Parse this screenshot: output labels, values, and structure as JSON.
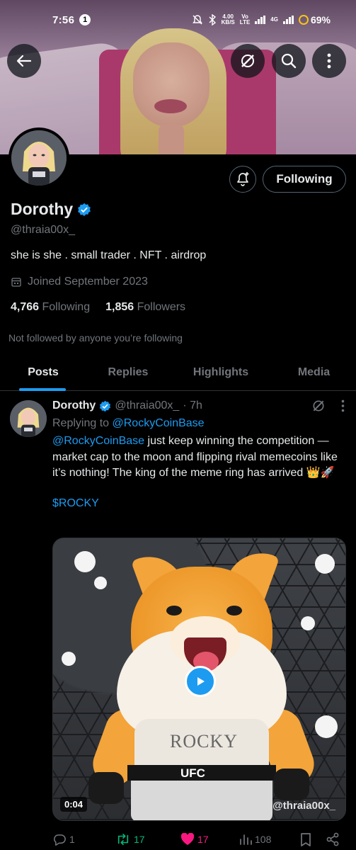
{
  "status_bar": {
    "time": "7:56",
    "notification_count": "1",
    "speed_value": "4.00",
    "speed_unit": "KB/S",
    "network_vo": "Vo",
    "network_lte": "LTE",
    "network_4g": "4G",
    "battery": "69%"
  },
  "profile": {
    "name": "Dorothy",
    "handle": "@thraia00x_",
    "bio": "she is she . small trader . NFT . airdrop",
    "joined": "Joined September 2023",
    "following_count": "4,766",
    "following_label": "Following",
    "followers_count": "1,856",
    "followers_label": "Followers",
    "not_followed": "Not followed by anyone you’re following",
    "follow_button": "Following",
    "verified_color": "#1d9bf0"
  },
  "tabs": [
    "Posts",
    "Replies",
    "Highlights",
    "Media"
  ],
  "active_tab": "Posts",
  "post": {
    "name": "Dorothy",
    "handle": "@thraia00x_",
    "time": "· 7h",
    "replying_prefix": "Replying to",
    "replying_to": "@RockyCoinBase",
    "text_mention": "@RockyCoinBase",
    "text": " just keep winning the competition — market cap to the moon and flipping rival memecoins like it’s nothing! The king of the meme ring has arrived 👑🚀",
    "cashtag": "$ROCKY",
    "video_duration": "0:04",
    "watermark": "@thraia00x_",
    "media_text_belt": "UFC",
    "media_text_shirt": "ROCKY",
    "replies": "1",
    "retweets": "17",
    "likes": "17",
    "views": "108"
  },
  "colors": {
    "accent": "#1d9bf0",
    "retweet": "#00ba7c",
    "like": "#f91880",
    "muted": "#71767b"
  }
}
